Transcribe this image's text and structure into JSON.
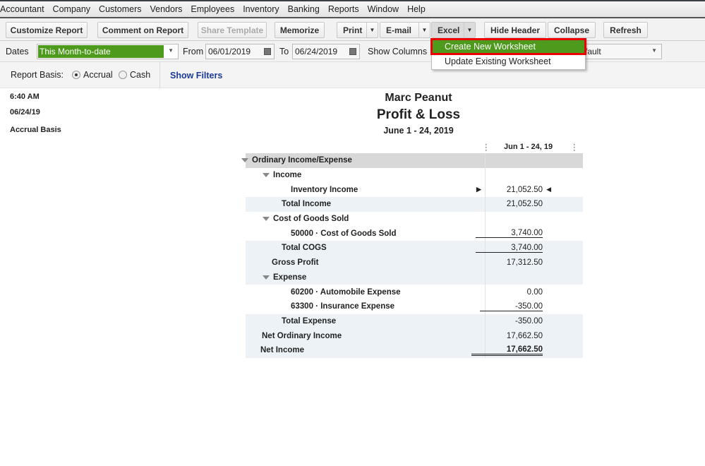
{
  "menu": [
    "Accountant",
    "Company",
    "Customers",
    "Vendors",
    "Employees",
    "Inventory",
    "Banking",
    "Reports",
    "Window",
    "Help"
  ],
  "toolbar": {
    "customize": "Customize Report",
    "comment": "Comment on Report",
    "share": "Share Template",
    "memorize": "Memorize",
    "print": "Print",
    "email": "E-mail",
    "excel": "Excel",
    "hide_header": "Hide Header",
    "collapse": "Collapse",
    "refresh": "Refresh"
  },
  "excel_menu": {
    "create": "Create New Worksheet",
    "update": "Update Existing Worksheet"
  },
  "datebar": {
    "dates_label": "Dates",
    "dates_value": "This Month-to-date",
    "from_label": "From",
    "from_value": "06/01/2019",
    "to_label": "To",
    "to_value": "06/24/2019",
    "show_columns_label": "Show Columns",
    "columns_value": "fault"
  },
  "basis": {
    "label": "Report Basis:",
    "accrual": "Accrual",
    "cash": "Cash",
    "filters": "Show Filters"
  },
  "meta": {
    "time": "6:40 AM",
    "date": "06/24/19",
    "basis": "Accrual Basis"
  },
  "report": {
    "company": "Marc Peanut",
    "title": "Profit & Loss",
    "period": "June 1 - 24, 2019",
    "column": "Jun 1 - 24, 19",
    "rows": [
      {
        "label": "Ordinary Income/Expense",
        "amount": ""
      },
      {
        "label": "Income",
        "amount": ""
      },
      {
        "label": "Inventory Income",
        "amount": "21,052.50"
      },
      {
        "label": "Total Income",
        "amount": "21,052.50"
      },
      {
        "label": "Cost of Goods Sold",
        "amount": ""
      },
      {
        "label": "50000 · Cost of Goods Sold",
        "amount": "3,740.00"
      },
      {
        "label": "Total COGS",
        "amount": "3,740.00"
      },
      {
        "label": "Gross Profit",
        "amount": "17,312.50"
      },
      {
        "label": "Expense",
        "amount": ""
      },
      {
        "label": "60200 · Automobile Expense",
        "amount": "0.00"
      },
      {
        "label": "63300 · Insurance Expense",
        "amount": "-350.00"
      },
      {
        "label": "Total Expense",
        "amount": "-350.00"
      },
      {
        "label": "Net Ordinary Income",
        "amount": "17,662.50"
      },
      {
        "label": "Net Income",
        "amount": "17,662.50"
      }
    ]
  }
}
